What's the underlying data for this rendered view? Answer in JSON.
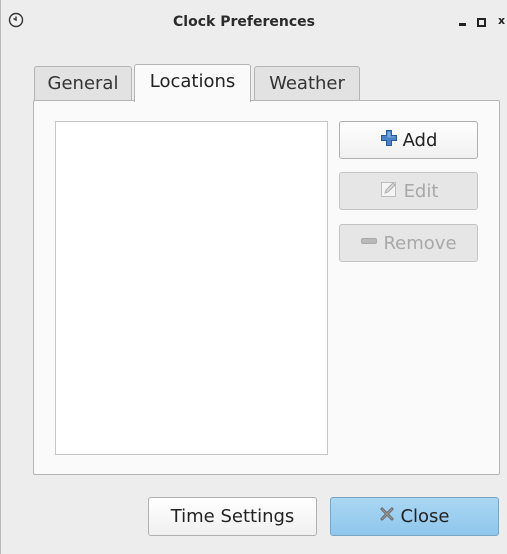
{
  "window": {
    "title": "Clock Preferences",
    "app_icon": "clock-icon",
    "controls": {
      "minimize": "minimize-icon",
      "maximize": "maximize-icon",
      "close": "x"
    }
  },
  "tabs": [
    {
      "label": "General",
      "active": false
    },
    {
      "label": "Locations",
      "active": true
    },
    {
      "label": "Weather",
      "active": false
    }
  ],
  "locations": {
    "items": [],
    "buttons": {
      "add": {
        "label": "Add",
        "icon": "plus-icon",
        "enabled": true
      },
      "edit": {
        "label": "Edit",
        "icon": "pencil-icon",
        "enabled": false
      },
      "remove": {
        "label": "Remove",
        "icon": "minus-icon",
        "enabled": false
      }
    }
  },
  "footer": {
    "time_settings": {
      "label": "Time Settings"
    },
    "close": {
      "label": "Close",
      "icon": "close-x-icon"
    }
  },
  "colors": {
    "background": "#ededed",
    "panel": "#fafafa",
    "accent_button": "#9dcdf0",
    "add_icon": "#3a6fb8"
  }
}
